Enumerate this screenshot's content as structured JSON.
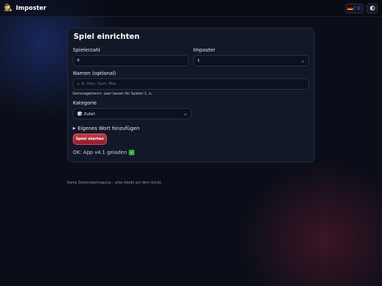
{
  "app": {
    "title": "Imposter",
    "icon": "spy-icon"
  },
  "topbar": {
    "lang_separator": "/",
    "languages": [
      "de",
      "en"
    ]
  },
  "card": {
    "title": "Spiel einrichten",
    "players": {
      "label": "Spielerzahl",
      "value": "6"
    },
    "imposters": {
      "label": "Imposter",
      "value": "1"
    },
    "names": {
      "label": "Namen (optional)",
      "placeholder": "z. B. Alex, Sam, Mia, …",
      "hint": "Kommagetrennt. Leer lassen für Spieler 1..n."
    },
    "category": {
      "label": "Kategorie",
      "icon": "🎲",
      "value": "Zufall"
    },
    "custom_word": {
      "label": "Eigenes Wort hinzufügen"
    },
    "start_label": "Spiel starten",
    "status": "OK: App v4.1 geladen",
    "status_check": "✓"
  },
  "footer": {
    "text": "Keine Datenübertragung – alles bleibt auf dem Gerät."
  },
  "colors": {
    "background": "#0b0e18",
    "card": "#121828",
    "accent": "#c63a47",
    "success": "#3aa43a"
  }
}
